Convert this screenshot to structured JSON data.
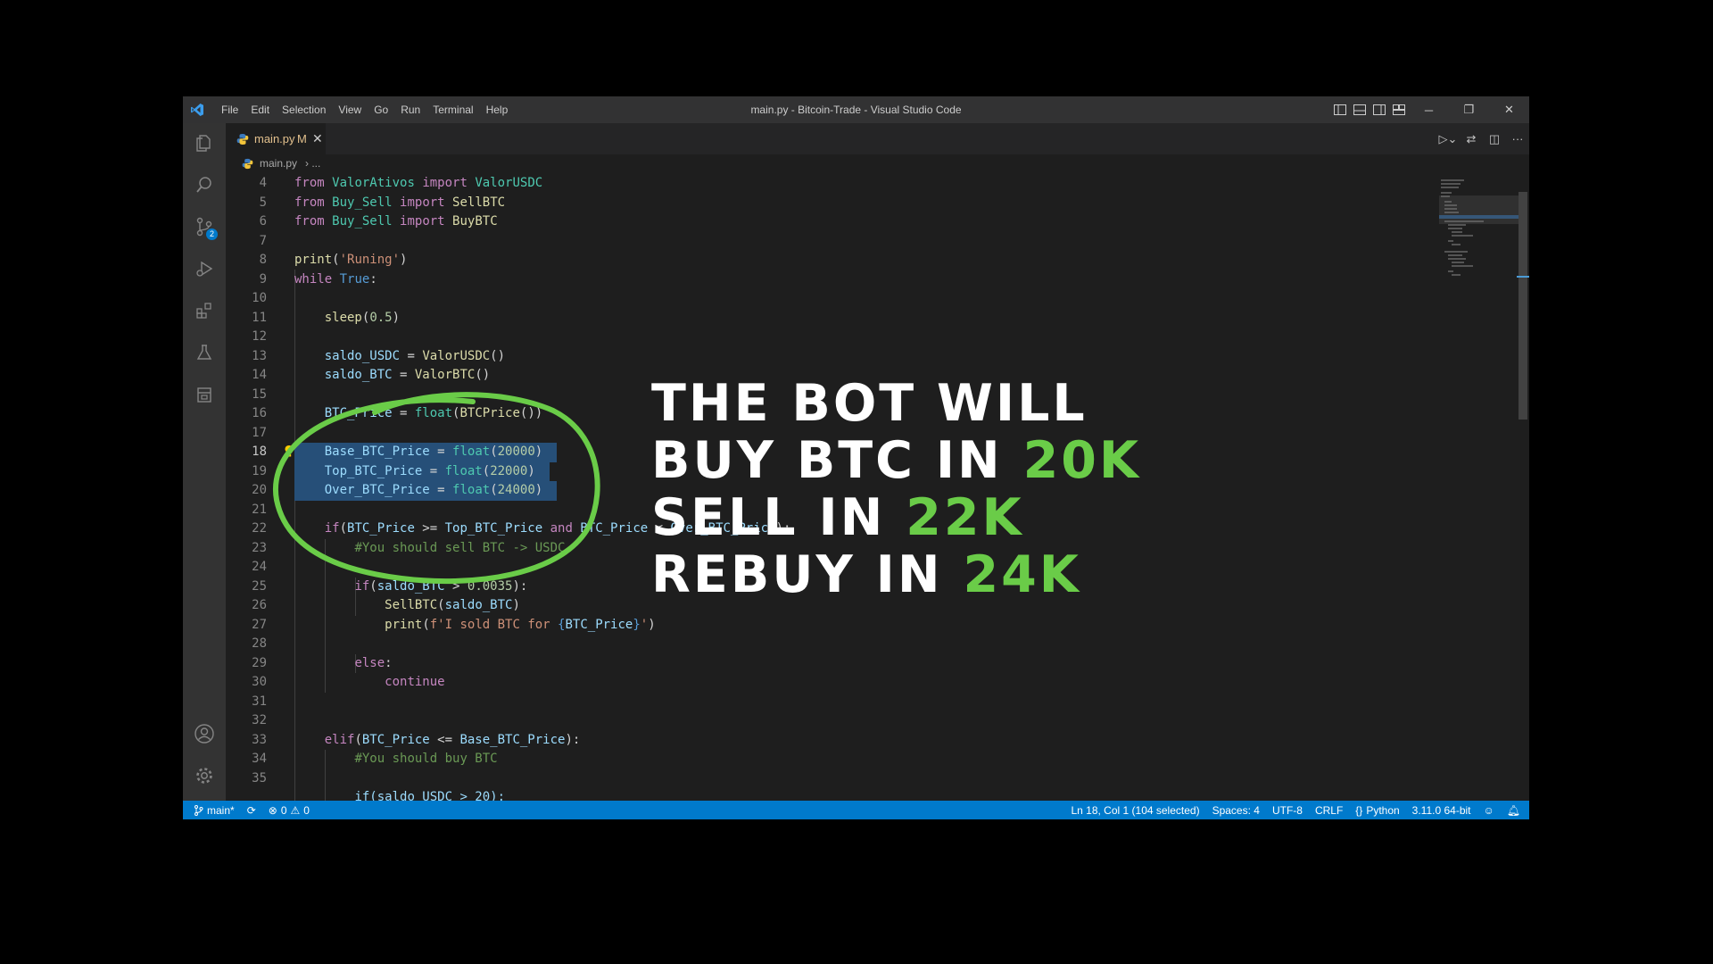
{
  "window": {
    "title": "main.py - Bitcoin-Trade - Visual Studio Code",
    "menus": [
      "File",
      "Edit",
      "Selection",
      "View",
      "Go",
      "Run",
      "Terminal",
      "Help"
    ]
  },
  "tab": {
    "label": "main.py",
    "modified": "M"
  },
  "breadcrumb": {
    "file": "main.py",
    "rest": "..."
  },
  "scm_badge": "2",
  "code_lines": [
    {
      "n": "4"
    },
    {
      "n": "5"
    },
    {
      "n": "6"
    },
    {
      "n": "7"
    },
    {
      "n": "8"
    },
    {
      "n": "9"
    },
    {
      "n": "10"
    },
    {
      "n": "11"
    },
    {
      "n": "12"
    },
    {
      "n": "13"
    },
    {
      "n": "14"
    },
    {
      "n": "15"
    },
    {
      "n": "16"
    },
    {
      "n": "17"
    },
    {
      "n": "18"
    },
    {
      "n": "19"
    },
    {
      "n": "20"
    },
    {
      "n": "21"
    },
    {
      "n": "22"
    },
    {
      "n": "23"
    },
    {
      "n": "24"
    },
    {
      "n": "25"
    },
    {
      "n": "26"
    },
    {
      "n": "27"
    },
    {
      "n": "28"
    },
    {
      "n": "29"
    },
    {
      "n": "30"
    },
    {
      "n": "31"
    },
    {
      "n": "32"
    },
    {
      "n": "33"
    },
    {
      "n": "34"
    },
    {
      "n": "35"
    }
  ],
  "tokens": {
    "from": "from",
    "import": "import",
    "while": "while",
    "true": "True",
    "if": "if",
    "elif": "elif",
    "else": "else",
    "continue": "continue",
    "and": "and",
    "ValorAtivos": "ValorAtivos",
    "ValorUSDC": "ValorUSDC",
    "Buy_Sell": "Buy_Sell",
    "SellBTC": "SellBTC",
    "BuyBTC": "BuyBTC",
    "print": "print",
    "runing": "'Runing'",
    "sleep": "sleep",
    "half": "0.5",
    "saldo_USDC": "saldo_USDC",
    "saldo_BTC": "saldo_BTC",
    "ValorBTC": "ValorBTC",
    "BTC_Price": "BTC_Price",
    "float": "float",
    "BTCPrice": "BTCPrice",
    "Base_BTC_Price": "Base_BTC_Price",
    "Top_BTC_Price": "Top_BTC_Price",
    "Over_BTC_Price": "Over_BTC_Price",
    "v20000": "20000",
    "v22000": "22000",
    "v24000": "24000",
    "cmt_sell": "#You should sell BTC -> USDC",
    "cmt_buy": "#You should buy BTC",
    "thresh": "0.0035",
    "fstr_a": "f'I sold BTC for ",
    "fstr_b": "'",
    "line36": "if(saldo_USDC > 20):"
  },
  "status": {
    "branch": "main*",
    "errors": "0",
    "warnings": "0",
    "position": "Ln 18, Col 1 (104 selected)",
    "spaces": "Spaces: 4",
    "encoding": "UTF-8",
    "eol": "CRLF",
    "language": "Python",
    "interpreter": "3.11.0 64-bit"
  },
  "overlay": {
    "l1": "THE BOT WILL",
    "l2a": "BUY BTC IN ",
    "l2b": "20K",
    "l3a": "SELL IN ",
    "l3b": "22K",
    "l4a": "REBUY IN ",
    "l4b": "24K"
  },
  "colors": {
    "accent_green": "#6acc48",
    "status_blue": "#007acc",
    "selection": "#264f78"
  }
}
